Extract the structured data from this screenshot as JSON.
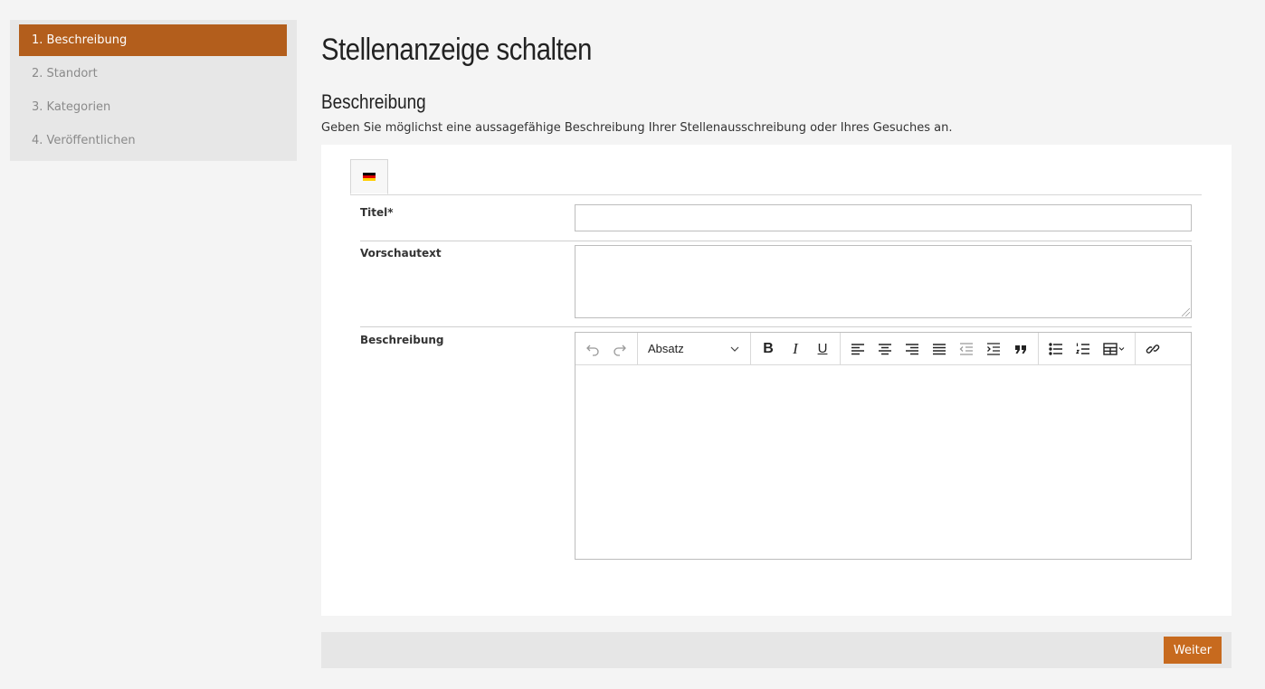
{
  "sidebar": {
    "steps": [
      {
        "label": "1. Beschreibung",
        "active": true
      },
      {
        "label": "2. Standort",
        "active": false
      },
      {
        "label": "3. Kategorien",
        "active": false
      },
      {
        "label": "4. Veröffentlichen",
        "active": false
      }
    ]
  },
  "main": {
    "page_title": "Stellenanzeige schalten",
    "section_title": "Beschreibung",
    "section_description": "Geben Sie möglichst eine aussagefähige Beschreibung Ihrer Stellenausschreibung oder Ihres Gesuches an."
  },
  "language_tab": {
    "icon": "flag-de-icon",
    "colors": [
      "#000000",
      "#dd0000",
      "#ffce00"
    ]
  },
  "form": {
    "title_label": "Titel*",
    "title_value": "",
    "preview_label": "Vorschautext",
    "preview_value": "",
    "description_label": "Beschreibung",
    "description_value": ""
  },
  "editor": {
    "format_selected": "Absatz",
    "buttons": [
      "undo-icon",
      "redo-icon",
      "bold-icon",
      "italic-icon",
      "underline-icon",
      "align-left-icon",
      "align-center-icon",
      "align-right-icon",
      "align-justify-icon",
      "outdent-icon",
      "indent-icon",
      "blockquote-icon",
      "bullet-list-icon",
      "numbered-list-icon",
      "table-icon",
      "link-icon"
    ]
  },
  "footer": {
    "next_label": "Weiter"
  },
  "colors": {
    "accent": "#b35e1c",
    "button": "#c76a1e",
    "background": "#f4f4f4"
  }
}
